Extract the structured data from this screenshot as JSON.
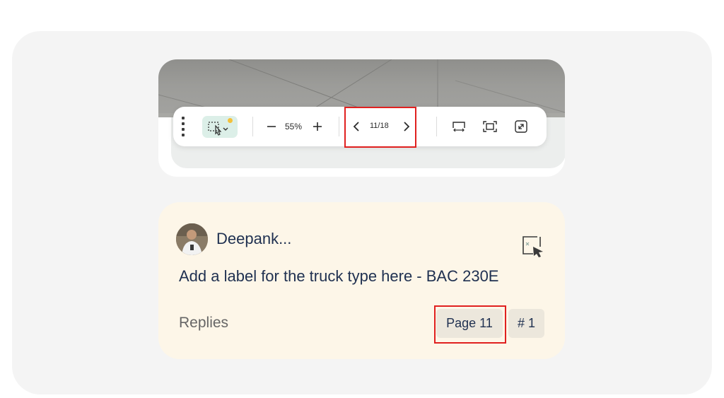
{
  "toolbar": {
    "zoom_level": "55%",
    "page_indicator": "11/18",
    "icons": [
      "drag-handle-icon",
      "select-pen-icon",
      "chevron-down-icon",
      "zoom-out-icon",
      "zoom-in-icon",
      "chevron-left-icon",
      "chevron-right-icon",
      "fit-width-icon",
      "fit-page-icon",
      "expand-icon"
    ],
    "accent_color": "#dcefe8",
    "notification_dot_color": "#f3c13a"
  },
  "comment": {
    "author": "Deepank...",
    "text": "Add a label for the truck type here - BAC 230E",
    "replies_label": "Replies",
    "page_chip": "Page 11",
    "number_chip": "# 1",
    "card_color": "#fdf6e8"
  },
  "highlight_color": "#e0201f"
}
